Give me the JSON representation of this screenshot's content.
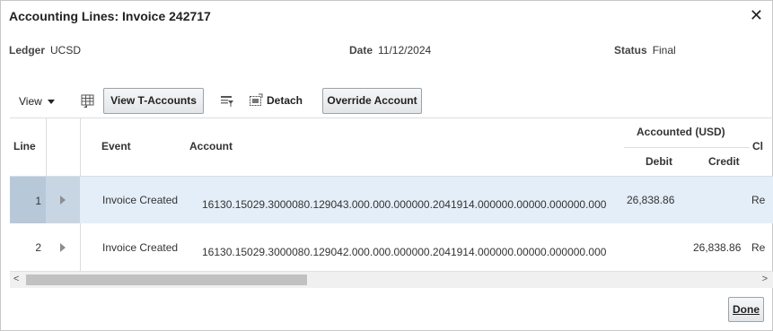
{
  "dialog": {
    "title": "Accounting Lines: Invoice 242717",
    "close_glyph": "✕"
  },
  "header": {
    "ledger_label": "Ledger",
    "ledger_value": "UCSD",
    "date_label": "Date",
    "date_value": "11/12/2024",
    "status_label": "Status",
    "status_value": "Final"
  },
  "toolbar": {
    "view_label": "View",
    "view_taccounts_label": "View T-Accounts",
    "detach_label": "Detach",
    "override_account_label": "Override Account",
    "icons": [
      "freeze-columns-icon",
      "query-by-example-icon",
      "detach-icon"
    ]
  },
  "table": {
    "columns": {
      "line": "Line",
      "event": "Event",
      "account": "Account",
      "accounted_group": "Accounted (USD)",
      "debit": "Debit",
      "credit": "Credit",
      "next_truncated": "Cl"
    },
    "rows": [
      {
        "line": "1",
        "event": "Invoice Created",
        "account": "16130.15029.3000080.129043.000.000.000000.2041914.000000.00000.000000.000",
        "debit": "26,838.86",
        "credit": "",
        "next_truncated": "Re",
        "selected": true
      },
      {
        "line": "2",
        "event": "Invoice Created",
        "account": "16130.15029.3000080.129042.000.000.000000.2041914.000000.00000.000000.000",
        "debit": "",
        "credit": "26,838.86",
        "next_truncated": "Re",
        "selected": false
      }
    ]
  },
  "scrollbar": {
    "left_arrow": "<",
    "right_arrow": ">"
  },
  "footer": {
    "done_label": "Done"
  }
}
